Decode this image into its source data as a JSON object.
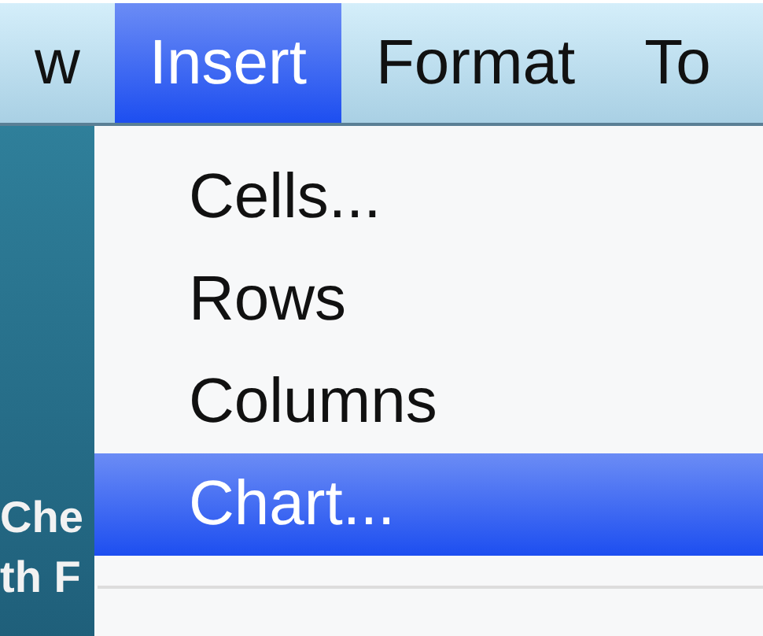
{
  "menu_bar": [
    {
      "label": "w",
      "selected": false
    },
    {
      "label": "Insert",
      "selected": true
    },
    {
      "label": "Format",
      "selected": false
    },
    {
      "label": "To",
      "selected": false
    }
  ],
  "background_texts": [
    "Che",
    "th F"
  ],
  "menu": {
    "items": [
      {
        "label": "Cells...",
        "selected": false
      },
      {
        "label": "Rows",
        "selected": false
      },
      {
        "label": "Columns",
        "selected": false
      },
      {
        "label": "Chart...",
        "selected": true
      }
    ],
    "separator": true
  }
}
